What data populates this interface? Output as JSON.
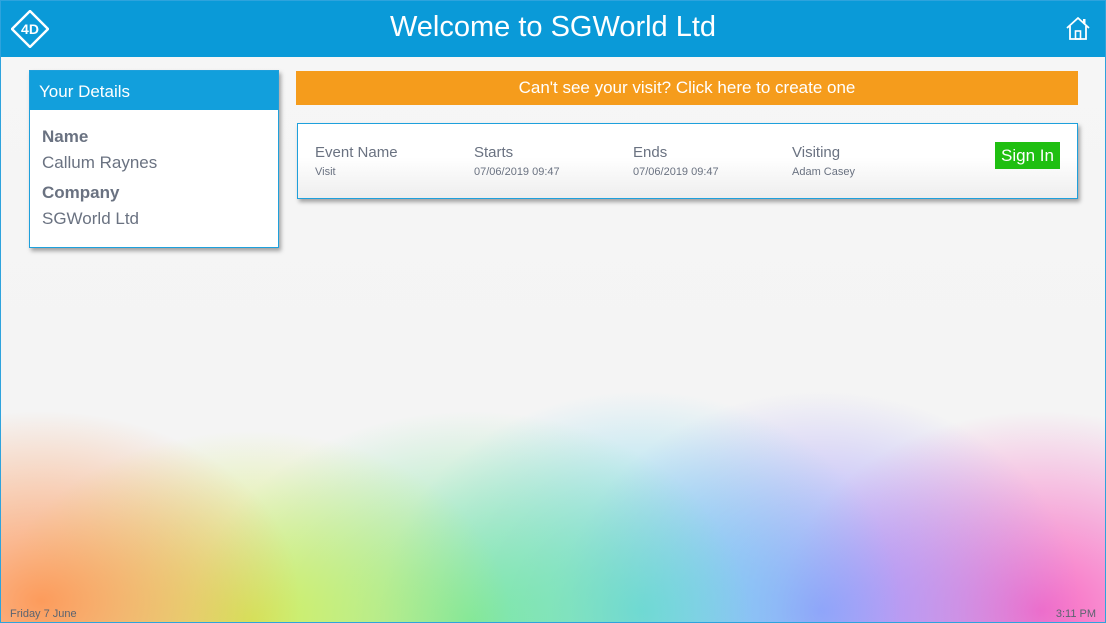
{
  "header": {
    "title": "Welcome to SGWorld Ltd",
    "logo_text": "4D",
    "logo_icon": "4d-diamond-logo",
    "home_icon": "home-icon",
    "color": "#0a9ad8"
  },
  "details": {
    "heading": "Your Details",
    "name_label": "Name",
    "name_value": "Callum Raynes",
    "company_label": "Company",
    "company_value": "SGWorld Ltd"
  },
  "banner": {
    "text": "Can't see your visit? Click here to create one",
    "color": "#f59c1c"
  },
  "visit": {
    "columns": [
      "Event Name",
      "Starts",
      "Ends",
      "Visiting"
    ],
    "values": [
      "Visit",
      "07/06/2019 09:47",
      "07/06/2019 09:47",
      "Adam Casey"
    ],
    "sign_in_label": "Sign In",
    "sign_in_color": "#1fbf11"
  },
  "footer": {
    "date": "Friday 7 June",
    "time": "3:11 PM"
  }
}
